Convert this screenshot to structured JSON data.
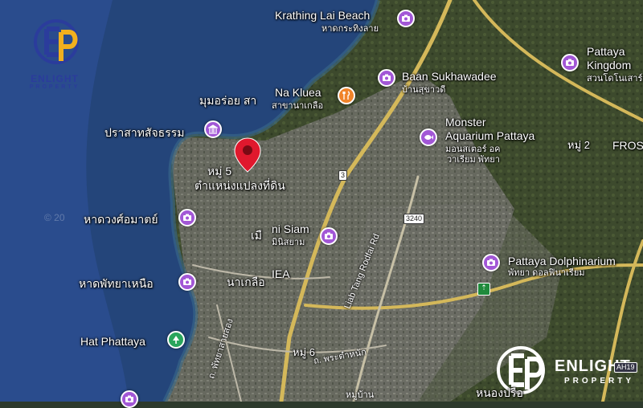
{
  "brand": {
    "name": "ENLIGHT",
    "sub": "PROPERTY",
    "colors": {
      "blue": "#2b3c9c",
      "gold": "#f2b01e",
      "white": "#ffffff"
    }
  },
  "watermark": "© 20",
  "marker": {
    "label": "หมู่ 5",
    "caption": "ตำแหน่งแปลงที่ดิน",
    "color": "#e0182d"
  },
  "places": {
    "krathing_lai": {
      "name": "Krathing Lai Beach",
      "thai": "หาดกระทิงลาย"
    },
    "na_kluea": {
      "name": "Na Kluea",
      "thai": "สาขานาเกลือ",
      "prefix": "มุมอร่อย สา"
    },
    "baan_sukhawadee": {
      "name": "Baan Sukhawadee",
      "thai": "บ้านสุขาวดี"
    },
    "sanctuary": {
      "thai": "ปราสาทสัจธรรม"
    },
    "monster_aquarium": {
      "line1": "Monster",
      "line2": "Aquarium Pattaya",
      "thai1": "มอนสเตอร์ อค",
      "thai2": "วาเรียม พัทยา"
    },
    "pattaya_kingdom": {
      "line1": "Pattaya",
      "line2": "Kingdom",
      "thai": "สวนโดโนเสาร์"
    },
    "moo2": {
      "label": "หมู่ 2"
    },
    "fros": {
      "label": "FROS"
    },
    "wong_amat": {
      "thai": "หาดวงศ์อมาตย์"
    },
    "mini_siam": {
      "name": "ni Siam",
      "thai": "มินิสยาม",
      "prefix": "เมื"
    },
    "north_pattaya_beach": {
      "thai": "หาดพัทยาเหนือ"
    },
    "dolphinarium": {
      "name": "Pattaya Dolphinarium",
      "thai": "พัทยา ดอลฟินาเรียม"
    },
    "naklua_area": {
      "thai": "นาเกลือ",
      "extra": "IEA"
    },
    "hat_phattaya": {
      "name": "Hat Phattaya"
    },
    "moo6": {
      "label": "หมู่ 6"
    },
    "nong_prue": {
      "thai": "หนองปรือ"
    }
  },
  "roads": {
    "r3": "3",
    "r3240": "3240",
    "ah19": "AH19",
    "luang": "Liab Tang Rodfai Rd",
    "pra_tamnak": "ถ. พระตำหนัก",
    "sukhumvit_bypass": "ถ. พัทยาสายสอง",
    "moo_ban": "หมู่บ้าน"
  },
  "icons": {
    "attraction": "camera-icon",
    "food": "fork-knife-icon",
    "park": "tree-icon",
    "aquarium": "fish-icon",
    "pin": "location-pin-icon"
  },
  "poi_colors": {
    "attraction": "#a257d6",
    "food": "#f0842a",
    "park": "#2aa55c"
  }
}
